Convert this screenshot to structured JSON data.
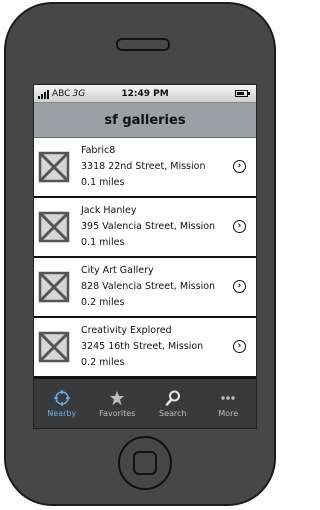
{
  "statusbar": {
    "carrier": "ABC",
    "network": "3G",
    "time": "12:49 PM"
  },
  "navbar": {
    "title": "sf galleries"
  },
  "galleries": [
    {
      "name": "Fabric8",
      "address": "3318 22nd Street, Mission",
      "distance": "0.1 miles"
    },
    {
      "name": "Jack Hanley",
      "address": "395 Valencia Street, Mission",
      "distance": "0.1 miles"
    },
    {
      "name": "City Art Gallery",
      "address": "828 Valencia Street, Mission",
      "distance": "0.2 miles"
    },
    {
      "name": "Creativity Explored",
      "address": "3245 16th Street, Mission",
      "distance": "0.2 miles"
    }
  ],
  "tabbar": {
    "tabs": [
      {
        "label": "Nearby",
        "icon": "crosshair-icon",
        "active": true
      },
      {
        "label": "Favorites",
        "icon": "star-icon",
        "active": false
      },
      {
        "label": "Search",
        "icon": "magnifier-icon",
        "active": false
      },
      {
        "label": "More",
        "icon": "ellipsis-icon",
        "active": false
      }
    ]
  },
  "colors": {
    "active_tab": "#5ab2ff",
    "navbar": "#9c9fa3",
    "tabbar": "#3a3a3a"
  }
}
